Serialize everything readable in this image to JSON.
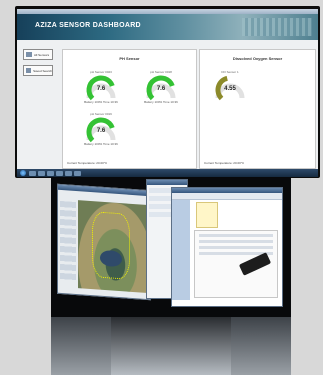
{
  "dashboard": {
    "title": "AZIZA SENSOR DASHBOARD",
    "sidebar": [
      {
        "label": "All Sensors",
        "icon": "sensor-icon"
      },
      {
        "label": "Saved Searches",
        "icon": "chart-icon"
      }
    ],
    "ph_panel": {
      "title": "PH Sensor",
      "gauges": [
        {
          "name": "pH Sensor 0023",
          "value": "7.6",
          "fill": 0.76,
          "sub": "Battery 100% Time 10:36"
        },
        {
          "name": "pH Sensor 0018",
          "value": "7.6",
          "fill": 0.76,
          "sub": "Battery 100% Time 10:36"
        },
        {
          "name": "pH Sensor 0019",
          "value": "7.6",
          "fill": 0.76,
          "sub": "Battery 100% Time 10:36"
        }
      ],
      "footer": "Current Temperature: 20.00°C"
    },
    "do_panel": {
      "title": "Dissolved Oxygen Sensor",
      "gauges": [
        {
          "name": "DO Sensor 1",
          "value": "4.55",
          "fill": 0.45,
          "sub": ""
        }
      ],
      "footer": "Current Temperature: 20.00°C"
    },
    "colors": {
      "ph_gauge": "#34c234",
      "do_gauge": "#8c8a2a",
      "gauge_track": "#e1e1e1"
    }
  }
}
